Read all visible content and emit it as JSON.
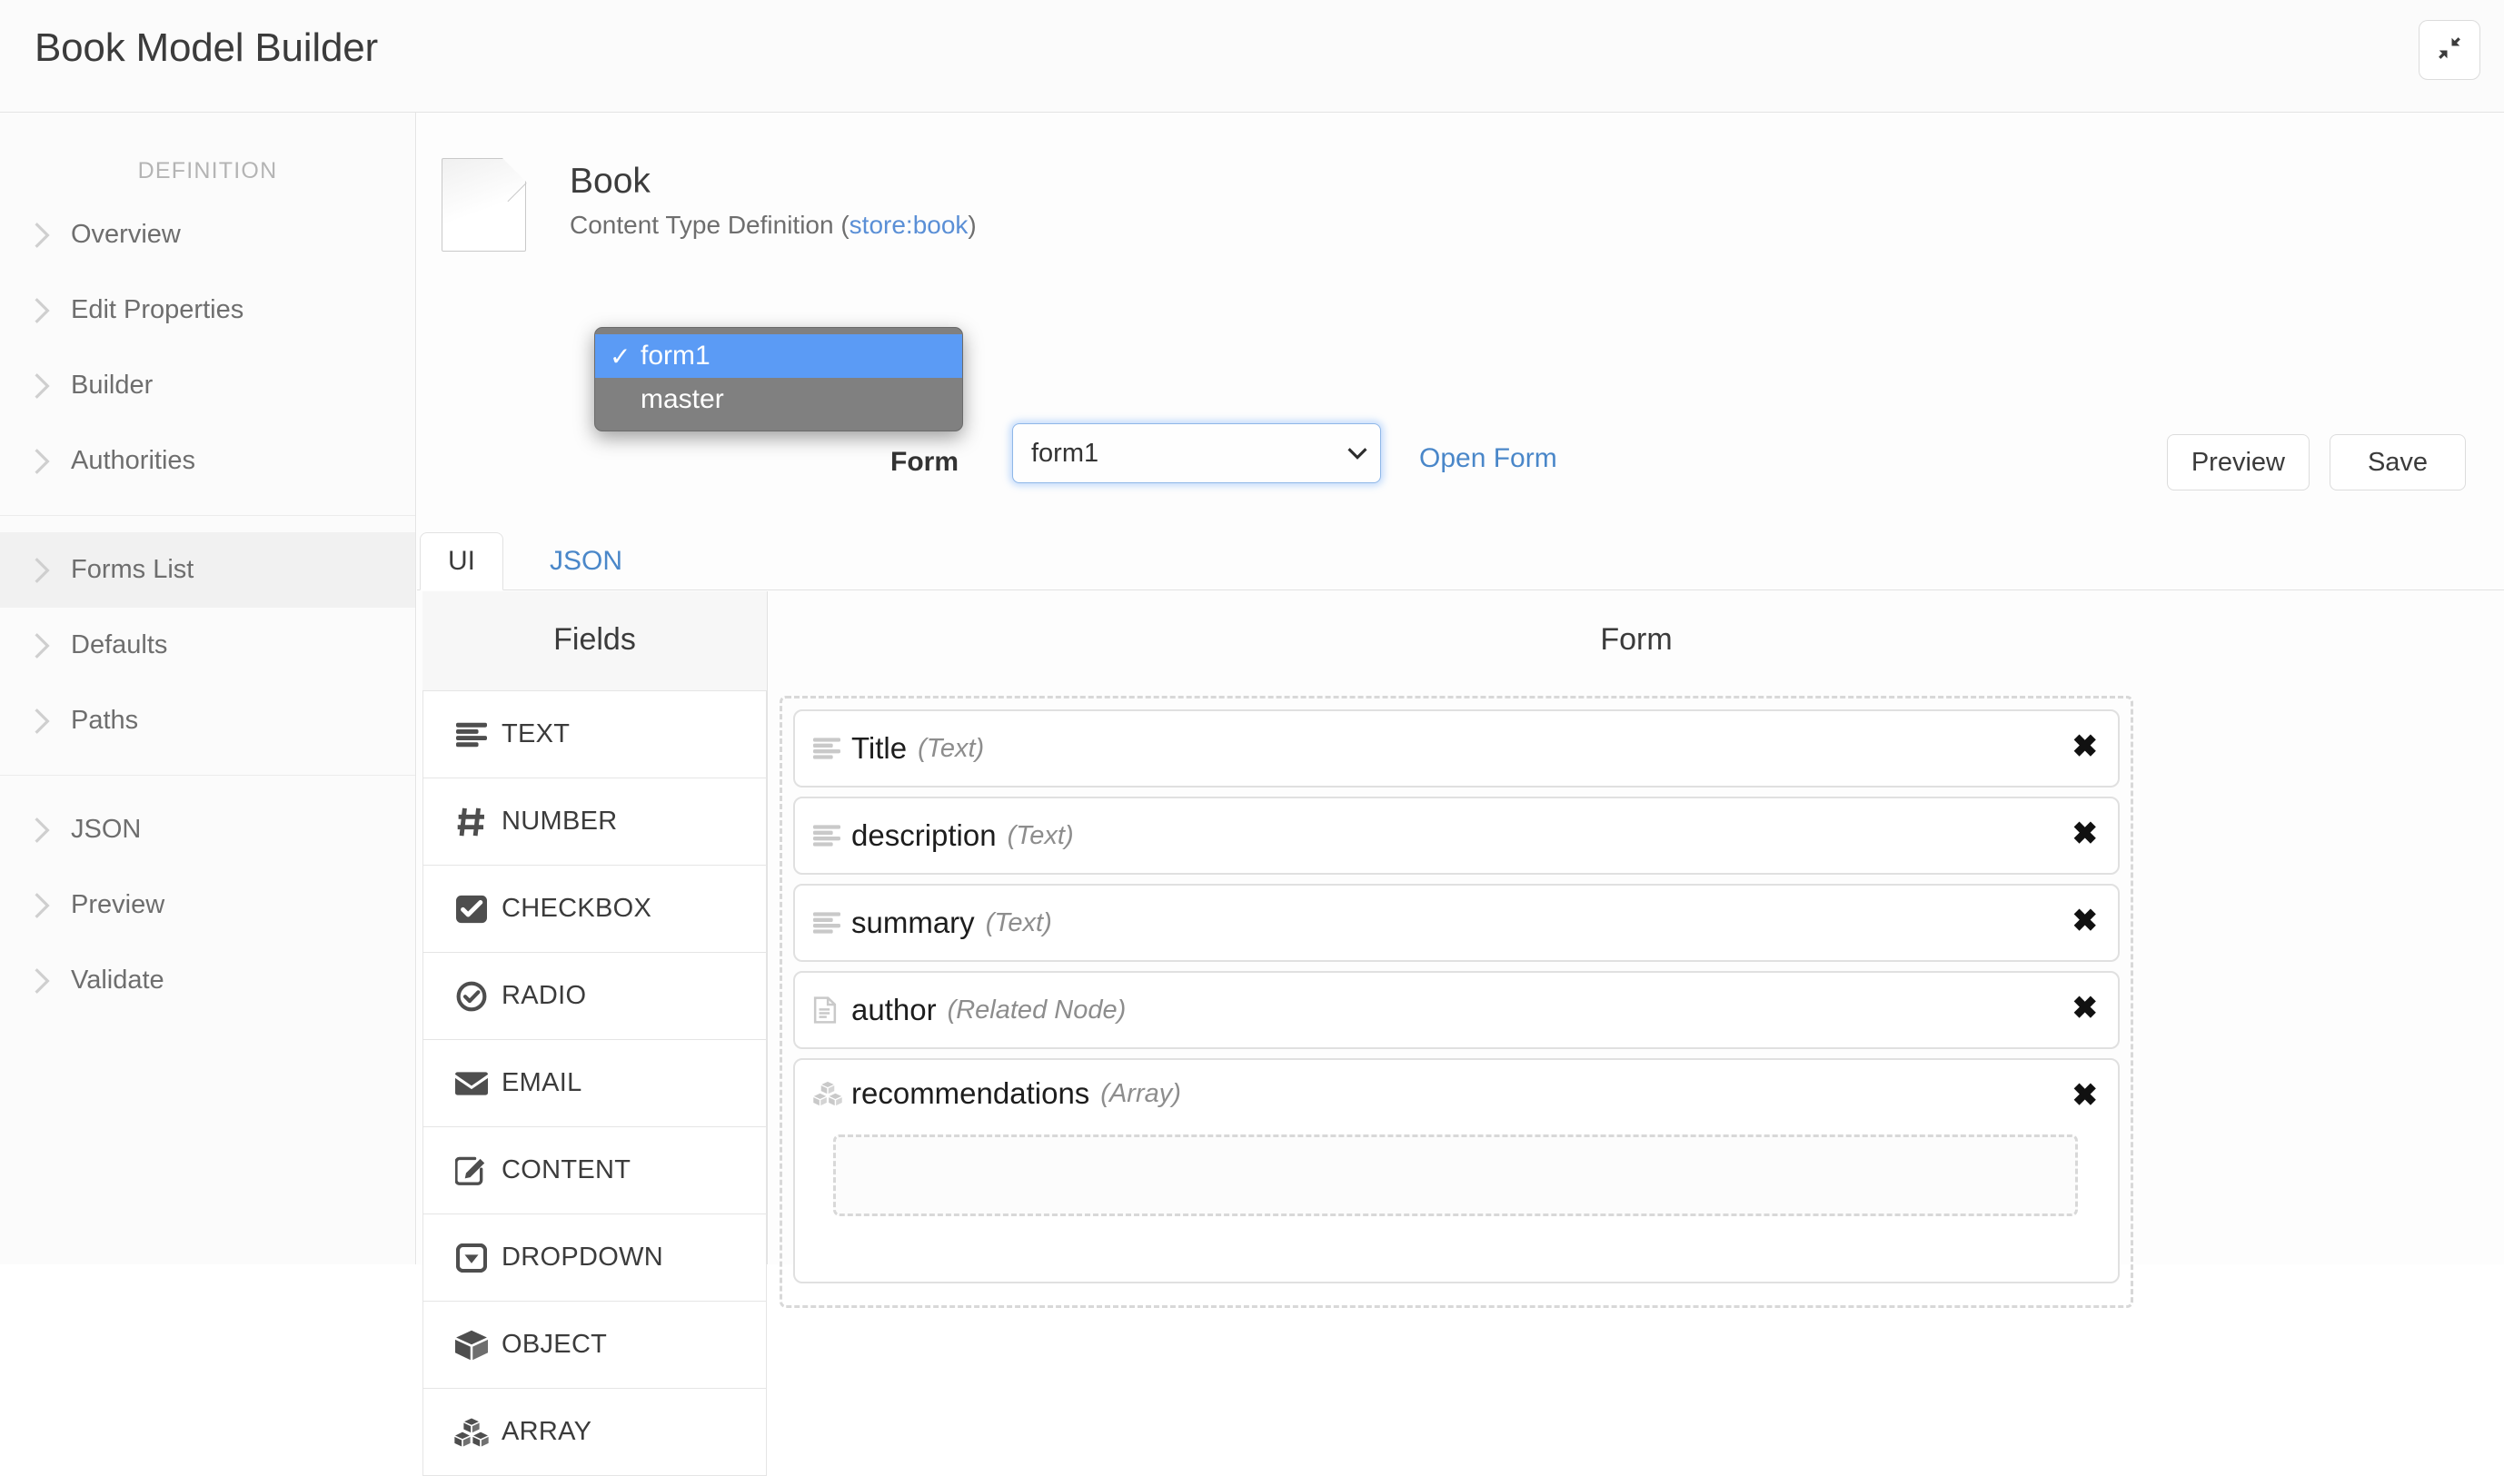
{
  "topbar": {
    "title": "Book Model Builder",
    "collapse_button_icon": "compress-icon"
  },
  "sidebar": {
    "heading": "DEFINITION",
    "groups": [
      {
        "items": [
          {
            "label": "Overview",
            "icon": "chevron-right-icon",
            "active": false
          },
          {
            "label": "Edit Properties",
            "icon": "chevron-right-icon",
            "active": false
          },
          {
            "label": "Builder",
            "icon": "chevron-right-icon",
            "active": false
          },
          {
            "label": "Authorities",
            "icon": "chevron-right-icon",
            "active": false
          }
        ]
      },
      {
        "items": [
          {
            "label": "Forms List",
            "icon": "chevron-right-icon",
            "active": true
          },
          {
            "label": "Defaults",
            "icon": "chevron-right-icon",
            "active": false
          },
          {
            "label": "Paths",
            "icon": "chevron-right-icon",
            "active": false
          }
        ]
      },
      {
        "items": [
          {
            "label": "JSON",
            "icon": "chevron-right-icon",
            "active": false
          },
          {
            "label": "Preview",
            "icon": "chevron-right-icon",
            "active": false
          },
          {
            "label": "Validate",
            "icon": "chevron-right-icon",
            "active": false
          }
        ]
      }
    ]
  },
  "document": {
    "icon": "file-document-icon",
    "title": "Book",
    "subtitle_prefix": "Content Type Definition (",
    "subtitle_link": "store:book",
    "subtitle_suffix": ")"
  },
  "form_selector": {
    "label": "Form",
    "selected_value": "form1",
    "caret_icon": "chevron-down-icon",
    "options": [
      {
        "label": "form1",
        "selected": true,
        "tick": "✓"
      },
      {
        "label": "master",
        "selected": false,
        "tick": ""
      }
    ],
    "open_form_link": "Open Form"
  },
  "toolbar": {
    "preview_label": "Preview",
    "save_label": "Save"
  },
  "tabs": [
    {
      "label": "UI",
      "active": true
    },
    {
      "label": "JSON",
      "active": false
    }
  ],
  "fields_panel": {
    "title": "Fields",
    "items": [
      {
        "label": "TEXT",
        "icon": "align-justify-icon"
      },
      {
        "label": "NUMBER",
        "icon": "hash-icon"
      },
      {
        "label": "CHECKBOX",
        "icon": "checkbox-checked-icon"
      },
      {
        "label": "RADIO",
        "icon": "circle-check-icon"
      },
      {
        "label": "EMAIL",
        "icon": "envelope-icon"
      },
      {
        "label": "CONTENT",
        "icon": "pencil-square-icon"
      },
      {
        "label": "DROPDOWN",
        "icon": "caret-square-down-icon"
      },
      {
        "label": "OBJECT",
        "icon": "cube-icon"
      },
      {
        "label": "ARRAY",
        "icon": "cubes-icon"
      }
    ]
  },
  "form_canvas": {
    "title": "Form",
    "delete_icon": "close-x-icon",
    "rows": [
      {
        "name": "Title",
        "type": "(Text)",
        "icon": "align-justify-icon",
        "has_nested_dropzone": false
      },
      {
        "name": "description",
        "type": "(Text)",
        "icon": "align-justify-icon",
        "has_nested_dropzone": false
      },
      {
        "name": "summary",
        "type": "(Text)",
        "icon": "align-justify-icon",
        "has_nested_dropzone": false
      },
      {
        "name": "author",
        "type": "(Related Node)",
        "icon": "file-text-icon",
        "has_nested_dropzone": false
      },
      {
        "name": "recommendations",
        "type": "(Array)",
        "icon": "cubes-icon",
        "has_nested_dropzone": true
      }
    ]
  },
  "colors": {
    "link": "#4a87c9",
    "select_highlight": "#5b9bf5",
    "menu_bg": "#808080",
    "focus_ring": "#8fb7e8"
  }
}
